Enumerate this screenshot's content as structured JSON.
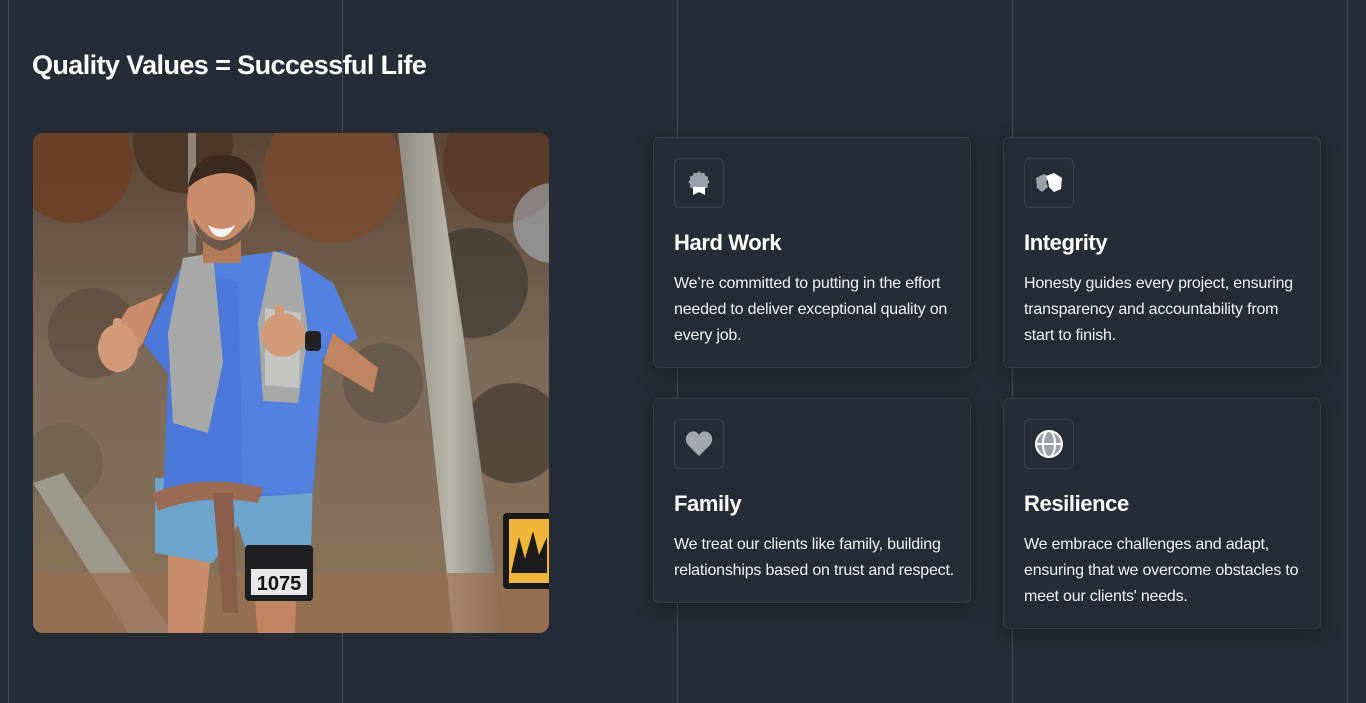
{
  "section": {
    "title": "Quality Values = Successful Life"
  },
  "photo": {
    "alt": "Runner giving thumbs up during a trail race",
    "bib_number": "1075"
  },
  "values": [
    {
      "icon": "award-icon",
      "title": "Hard Work",
      "description": "We’re committed to putting in the effort needed to deliver exceptional quality on every job."
    },
    {
      "icon": "handshake-icon",
      "title": "Integrity",
      "description": "Honesty guides every project, ensuring transparency and accountability from start to finish."
    },
    {
      "icon": "heart-icon",
      "title": "Family",
      "description": "We treat our clients like family, building relationships based on trust and respect."
    },
    {
      "icon": "globe-icon",
      "title": "Resilience",
      "description": "We embrace challenges and adapt, ensuring that we overcome obstacles to meet our clients' needs."
    }
  ],
  "colors": {
    "background": "#262c35",
    "card_border": "#363d47",
    "grid_line": "#434a54",
    "icon": "#c9ccd1",
    "text": "#ffffff"
  }
}
